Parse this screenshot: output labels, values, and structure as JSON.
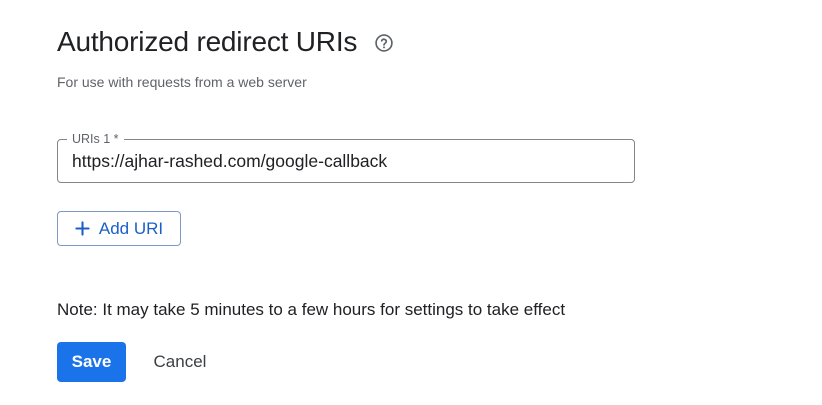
{
  "section": {
    "title": "Authorized redirect URIs",
    "help_icon": "help-circle-icon",
    "subtitle": "For use with requests from a web server"
  },
  "uri_field": {
    "label": "URIs 1 *",
    "value": "https://ajhar-rashed.com/google-callback"
  },
  "add_uri": {
    "icon": "plus-icon",
    "label": "Add URI"
  },
  "note": "Note: It may take 5 minutes to a few hours for settings to take effect",
  "actions": {
    "save_label": "Save",
    "cancel_label": "Cancel"
  },
  "colors": {
    "primary": "#1a73e8",
    "text": "#202124",
    "secondary_text": "#5f6368",
    "field_border": "#80868b"
  }
}
